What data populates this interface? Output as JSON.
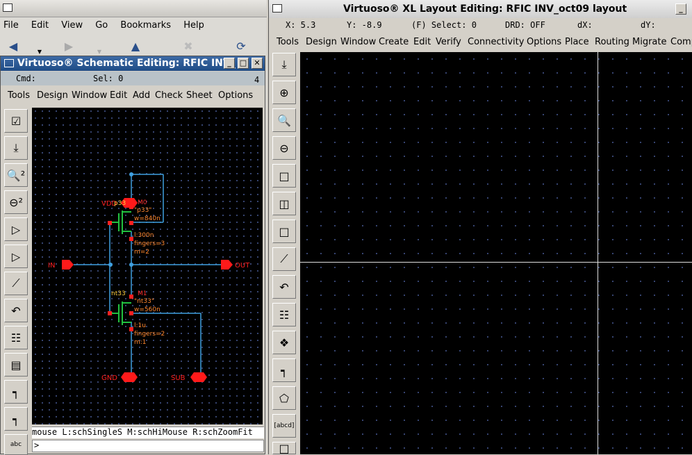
{
  "browser": {
    "menu": [
      "File",
      "Edit",
      "View",
      "Go",
      "Bookmarks",
      "Help"
    ]
  },
  "schematic": {
    "title": "Virtuoso® Schematic Editing: RFIC INV_",
    "window_number": "4",
    "status": {
      "cmd": "Cmd:",
      "sel": "Sel: 0"
    },
    "menu": [
      "Tools",
      "Design",
      "Window",
      "Edit",
      "Add",
      "Check",
      "Sheet",
      "Options"
    ],
    "mouse_line": "mouse L:schSingleS M:schHiMouse R:schZoomFit",
    "prompt": ">",
    "tools": [
      "check-icon",
      "save-icon",
      "zoom-in-icon",
      "zoom-out-icon",
      "stretch-icon",
      "copy-icon",
      "wire-icon",
      "undo-icon",
      "bus-icon",
      "instance-icon",
      "pin-icon",
      "label-icon",
      "note-icon"
    ],
    "circuit": {
      "pins": {
        "vdd": "VDD",
        "gnd": "GND",
        "in": "IN",
        "out": "OUT",
        "sub": "SUB"
      },
      "pmos": {
        "type": "p33",
        "name": "M0",
        "model": "\"p33\"",
        "w": "w=840n",
        "l": "l:300n",
        "fingers": "fingers=3",
        "m": "m=2"
      },
      "nmos": {
        "type": "nt33",
        "name": "M1",
        "model": "\"nt33\"",
        "w": "w=560n",
        "l": "l:1u",
        "fingers": "fingers=2",
        "m": "m:1"
      }
    }
  },
  "layout": {
    "title": "Virtuoso® XL Layout Editing: RFIC INV_oct09 layout",
    "status": {
      "x": "X: 5.3",
      "y": "Y: -8.9",
      "select": "(F) Select: 0",
      "drd": "DRD: OFF",
      "dx": "dX:",
      "dy": "dY:"
    },
    "menu": [
      "Tools",
      "Design",
      "Window",
      "Create",
      "Edit",
      "Verify",
      "Connectivity",
      "Options",
      "Place",
      "Routing",
      "Migrate",
      "Comp"
    ],
    "tools": [
      "save-icon",
      "zoom-fit-icon",
      "zoom-in-icon",
      "zoom-out-icon",
      "stretch-icon",
      "copy-icon",
      "move-icon",
      "wire-icon",
      "undo-icon",
      "via-icon",
      "path-icon",
      "shape-icon",
      "polygon-icon",
      "label-icon",
      "instance-icon"
    ],
    "tool_label_abcd": "[abcd]"
  },
  "colors": {
    "accent_title": "#1f4c86",
    "wire": "#3fa0e0",
    "pin": "#ff1a1a",
    "device": "#22c040",
    "prop": "#ff8830",
    "label_yellow": "#ffd040"
  }
}
